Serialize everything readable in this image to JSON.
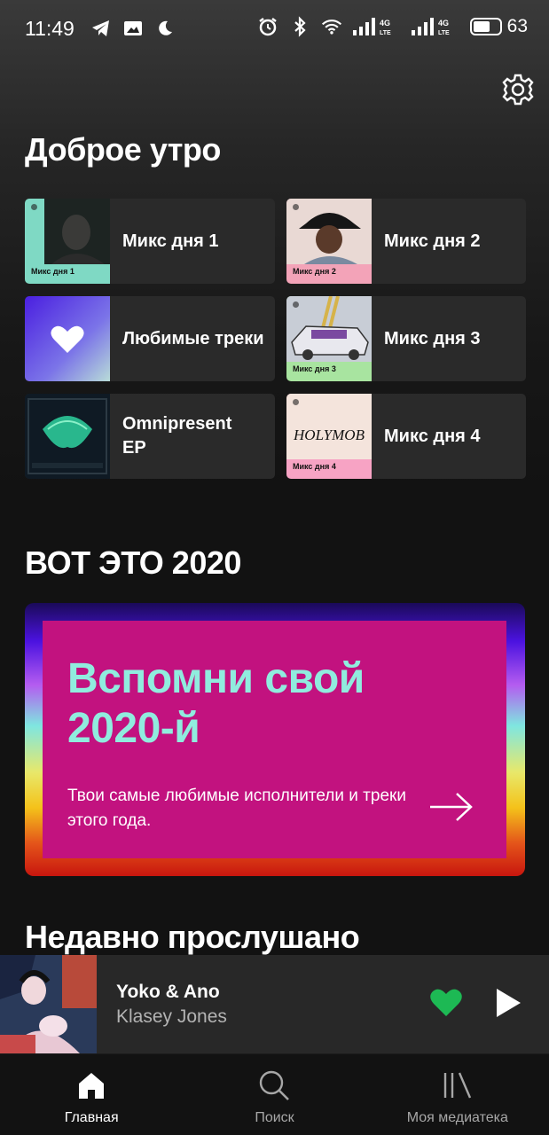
{
  "status_bar": {
    "time": "11:49",
    "left_icons": [
      "telegram-icon",
      "gallery-icon",
      "moon-icon"
    ],
    "right_icons": [
      "alarm-icon",
      "bluetooth-icon",
      "wifi-icon",
      "signal-4g-icon",
      "signal-4g-icon"
    ],
    "network_label": "4G",
    "network_sub": "LTE",
    "battery": "63"
  },
  "header": {
    "settings_icon": "gear-icon"
  },
  "greeting": "Доброе утро",
  "shortcuts": [
    {
      "label": "Микс дня 1",
      "art_caption": "Микс дня 1",
      "art_color": "#7fd9c4"
    },
    {
      "label": "Микс дня 2",
      "art_caption": "Микс дня 2",
      "art_color": "#f3a3b8"
    },
    {
      "label": "Любимые треки",
      "art_caption": "",
      "art_color": "#5a3df0"
    },
    {
      "label": "Микс дня 3",
      "art_caption": "Микс дня 3",
      "art_color": "#a8e4a0"
    },
    {
      "label": "Omnipresent EP",
      "art_caption": "",
      "art_color": "#0f1a24"
    },
    {
      "label": "Микс дня 4",
      "art_caption": "Микс дня 4",
      "art_color": "#f7a3c4",
      "art_text": "HOLYMOB"
    }
  ],
  "wrapped": {
    "section_title": "ВОТ ЭТО 2020",
    "title": "Вспомни свой 2020-й",
    "description": "Твои самые любимые исполнители и треки этого года.",
    "arrow_icon": "arrow-right-icon",
    "colors": {
      "card": "#c2127f",
      "title": "#90ecde"
    }
  },
  "recent": {
    "section_title": "Недавно прослушано"
  },
  "now_playing": {
    "title": "Yoko & Ano",
    "artist": "Klasey Jones",
    "liked": true,
    "like_color": "#1db954"
  },
  "nav": [
    {
      "label": "Главная",
      "icon": "home-icon",
      "active": true
    },
    {
      "label": "Поиск",
      "icon": "search-icon",
      "active": false
    },
    {
      "label": "Моя медиатека",
      "icon": "library-icon",
      "active": false
    }
  ]
}
